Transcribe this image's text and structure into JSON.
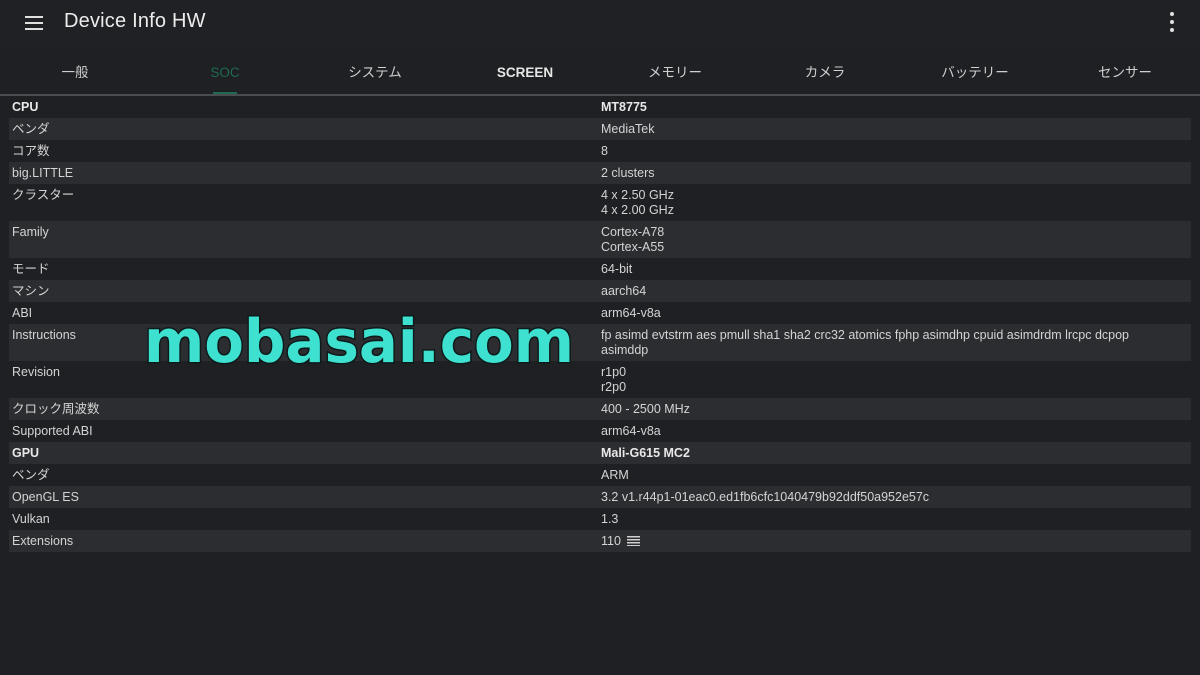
{
  "appbar": {
    "title": "Device Info HW",
    "menu_icon": "hamburger-menu-icon",
    "overflow_icon": "more-vert-icon"
  },
  "tabs": [
    {
      "label": "一般"
    },
    {
      "label": "SOC"
    },
    {
      "label": "システム"
    },
    {
      "label": "SCREEN"
    },
    {
      "label": "メモリー"
    },
    {
      "label": "カメラ"
    },
    {
      "label": "バッテリー"
    },
    {
      "label": "センサー"
    }
  ],
  "active_tab": "SOC",
  "colors": {
    "accent": "#1f6b52",
    "background": "#1f2023",
    "row_alt": "#2c2d30",
    "watermark": "#3ee0cf"
  },
  "rows": [
    {
      "key": "CPU",
      "value": "MT8775"
    },
    {
      "key": "ベンダ",
      "value": "MediaTek"
    },
    {
      "key": "コア数",
      "value": "8"
    },
    {
      "key": "big.LITTLE",
      "value": "2 clusters"
    },
    {
      "key": "クラスター",
      "value": "4 x 2.50 GHz",
      "value2": "4 x 2.00 GHz"
    },
    {
      "key": "Family",
      "value": "Cortex-A78",
      "value2": "Cortex-A55"
    },
    {
      "key": "モード",
      "value": "64-bit"
    },
    {
      "key": "マシン",
      "value": "aarch64"
    },
    {
      "key": "ABI",
      "value": "arm64-v8a"
    },
    {
      "key": "Instructions",
      "value": "fp asimd evtstrm aes pmull sha1 sha2 crc32 atomics fphp asimdhp cpuid asimdrdm lrcpc dcpop",
      "value2": "asimddp"
    },
    {
      "key": "Revision",
      "value": "r1p0",
      "value2": "r2p0"
    },
    {
      "key": "クロック周波数",
      "value": "400 - 2500 MHz"
    },
    {
      "key": "Supported ABI",
      "value": "arm64-v8a"
    },
    {
      "key": "GPU",
      "value": "Mali-G615 MC2"
    },
    {
      "key": "ベンダ",
      "value": "ARM"
    },
    {
      "key": "OpenGL ES",
      "value": "3.2 v1.r44p1-01eac0.ed1fb6cfc1040479b92ddf50a952e57c"
    },
    {
      "key": "Vulkan",
      "value": "1.3"
    },
    {
      "key": "Extensions",
      "value": "110"
    }
  ],
  "watermark": {
    "text": "mobasai.com"
  }
}
